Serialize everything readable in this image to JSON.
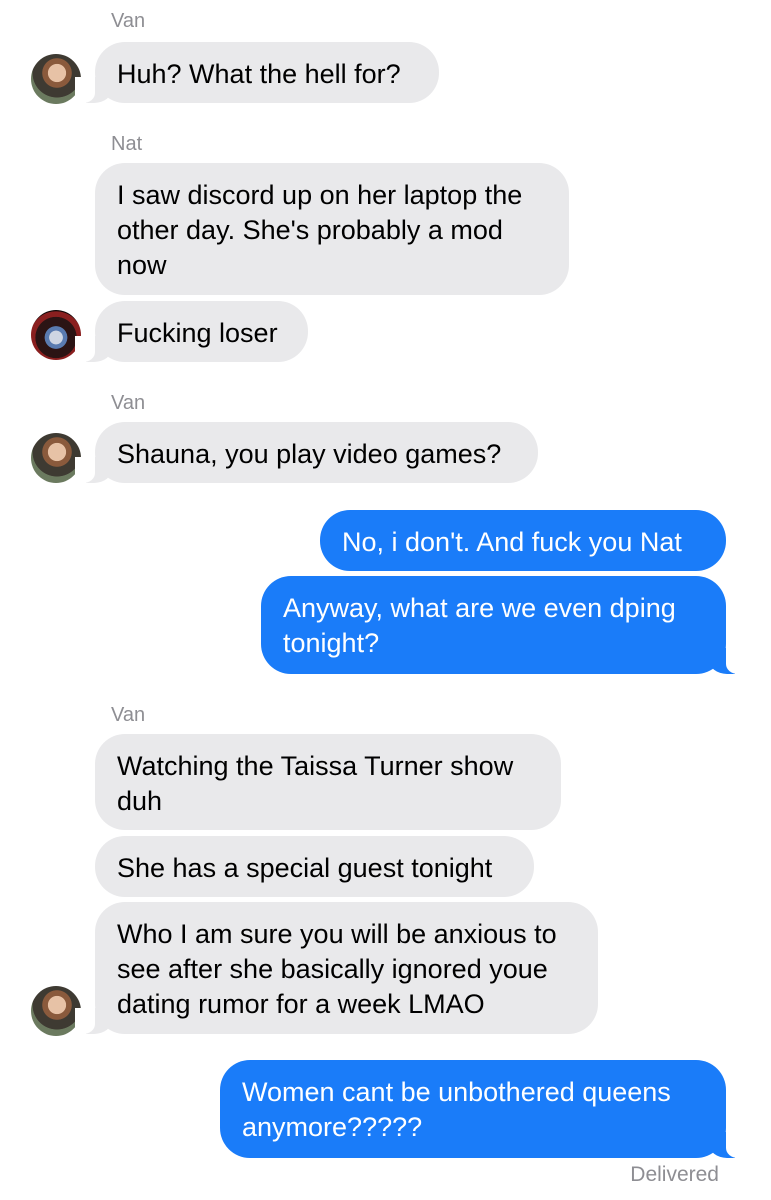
{
  "conversation": {
    "senders": {
      "van_1": "Van",
      "nat_1": "Nat",
      "van_2": "Van",
      "van_3": "Van"
    },
    "messages": {
      "m1": "Huh? What the hell for?",
      "m2": "I saw discord up on her laptop the other day. She's probably a mod now",
      "m3": "Fucking loser",
      "m4": "Shauna, you play video games?",
      "m5": "No, i don't. And fuck you Nat",
      "m6": "Anyway, what are we even dping tonight?",
      "m7": "Watching the Taissa Turner show duh",
      "m8": "She has a special guest tonight",
      "m9": "Who I am sure you will be anxious to see after she basically ignored youe dating rumor for a week LMAO",
      "m10": "Women cant be unbothered queens anymore?????"
    },
    "status": "Delivered"
  },
  "colors": {
    "incoming_bubble": "#e9e9eb",
    "outgoing_bubble": "#1a7cf9",
    "sender_label": "#8e8e93",
    "background": "#ffffff"
  },
  "icons": {
    "avatar_van": "avatar-van",
    "avatar_nat": "avatar-nat"
  }
}
